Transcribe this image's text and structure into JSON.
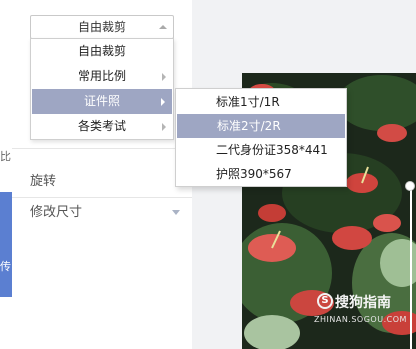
{
  "left_glyphs": [
    "比",
    "传"
  ],
  "crop_select": {
    "value": "自由裁剪"
  },
  "crop_menu": {
    "items": [
      {
        "label": "自由裁剪"
      },
      {
        "label": "常用比例"
      },
      {
        "label": "证件照"
      },
      {
        "label": "各类考试"
      }
    ]
  },
  "id_photo_submenu": {
    "items": [
      {
        "label": "标准1寸/1R"
      },
      {
        "label": "标准2寸/2R"
      },
      {
        "label": "二代身份证358*441"
      },
      {
        "label": "护照390*567"
      }
    ]
  },
  "sections": {
    "rotate": "旋转",
    "resize": "修改尺寸"
  },
  "watermark": {
    "brand": "搜狗指南",
    "url": "ZHINAN.SOGOU.COM",
    "logo_letter": "S"
  },
  "colors": {
    "highlight": "#9ea6c3",
    "accent_blue": "#5b7fd1"
  }
}
